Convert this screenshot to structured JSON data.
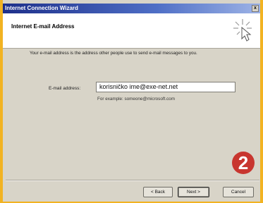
{
  "window": {
    "title": "Internet Connection Wizard",
    "close_label": "x"
  },
  "header": {
    "title": "Internet E-mail Address",
    "icon": "wizard-sparkle-icon"
  },
  "content": {
    "intro": "Your e-mail address is the address other people use to send e-mail messages to you.",
    "email_label": "E-mail address:",
    "email_value": "korisničko ime@exe-net.net",
    "example": "For example: someone@microsoft.com"
  },
  "badge": {
    "label": "2",
    "color": "#c8362f"
  },
  "buttons": {
    "back": "< Back",
    "next": "Next >",
    "cancel": "Cancel"
  }
}
